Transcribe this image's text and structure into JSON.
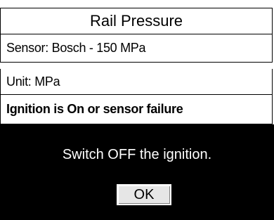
{
  "screen": {
    "title": "Rail Pressure",
    "sensor": "Sensor: Bosch - 150 MPa",
    "unit": "Unit: MPa",
    "error": "Ignition is On or sensor failure"
  },
  "dialog": {
    "message": "Switch OFF the ignition.",
    "ok_label": "OK"
  },
  "colors": {
    "dialog_background": "#000000",
    "dialog_text": "#ffffff",
    "button_face": "#e6e6e6"
  }
}
